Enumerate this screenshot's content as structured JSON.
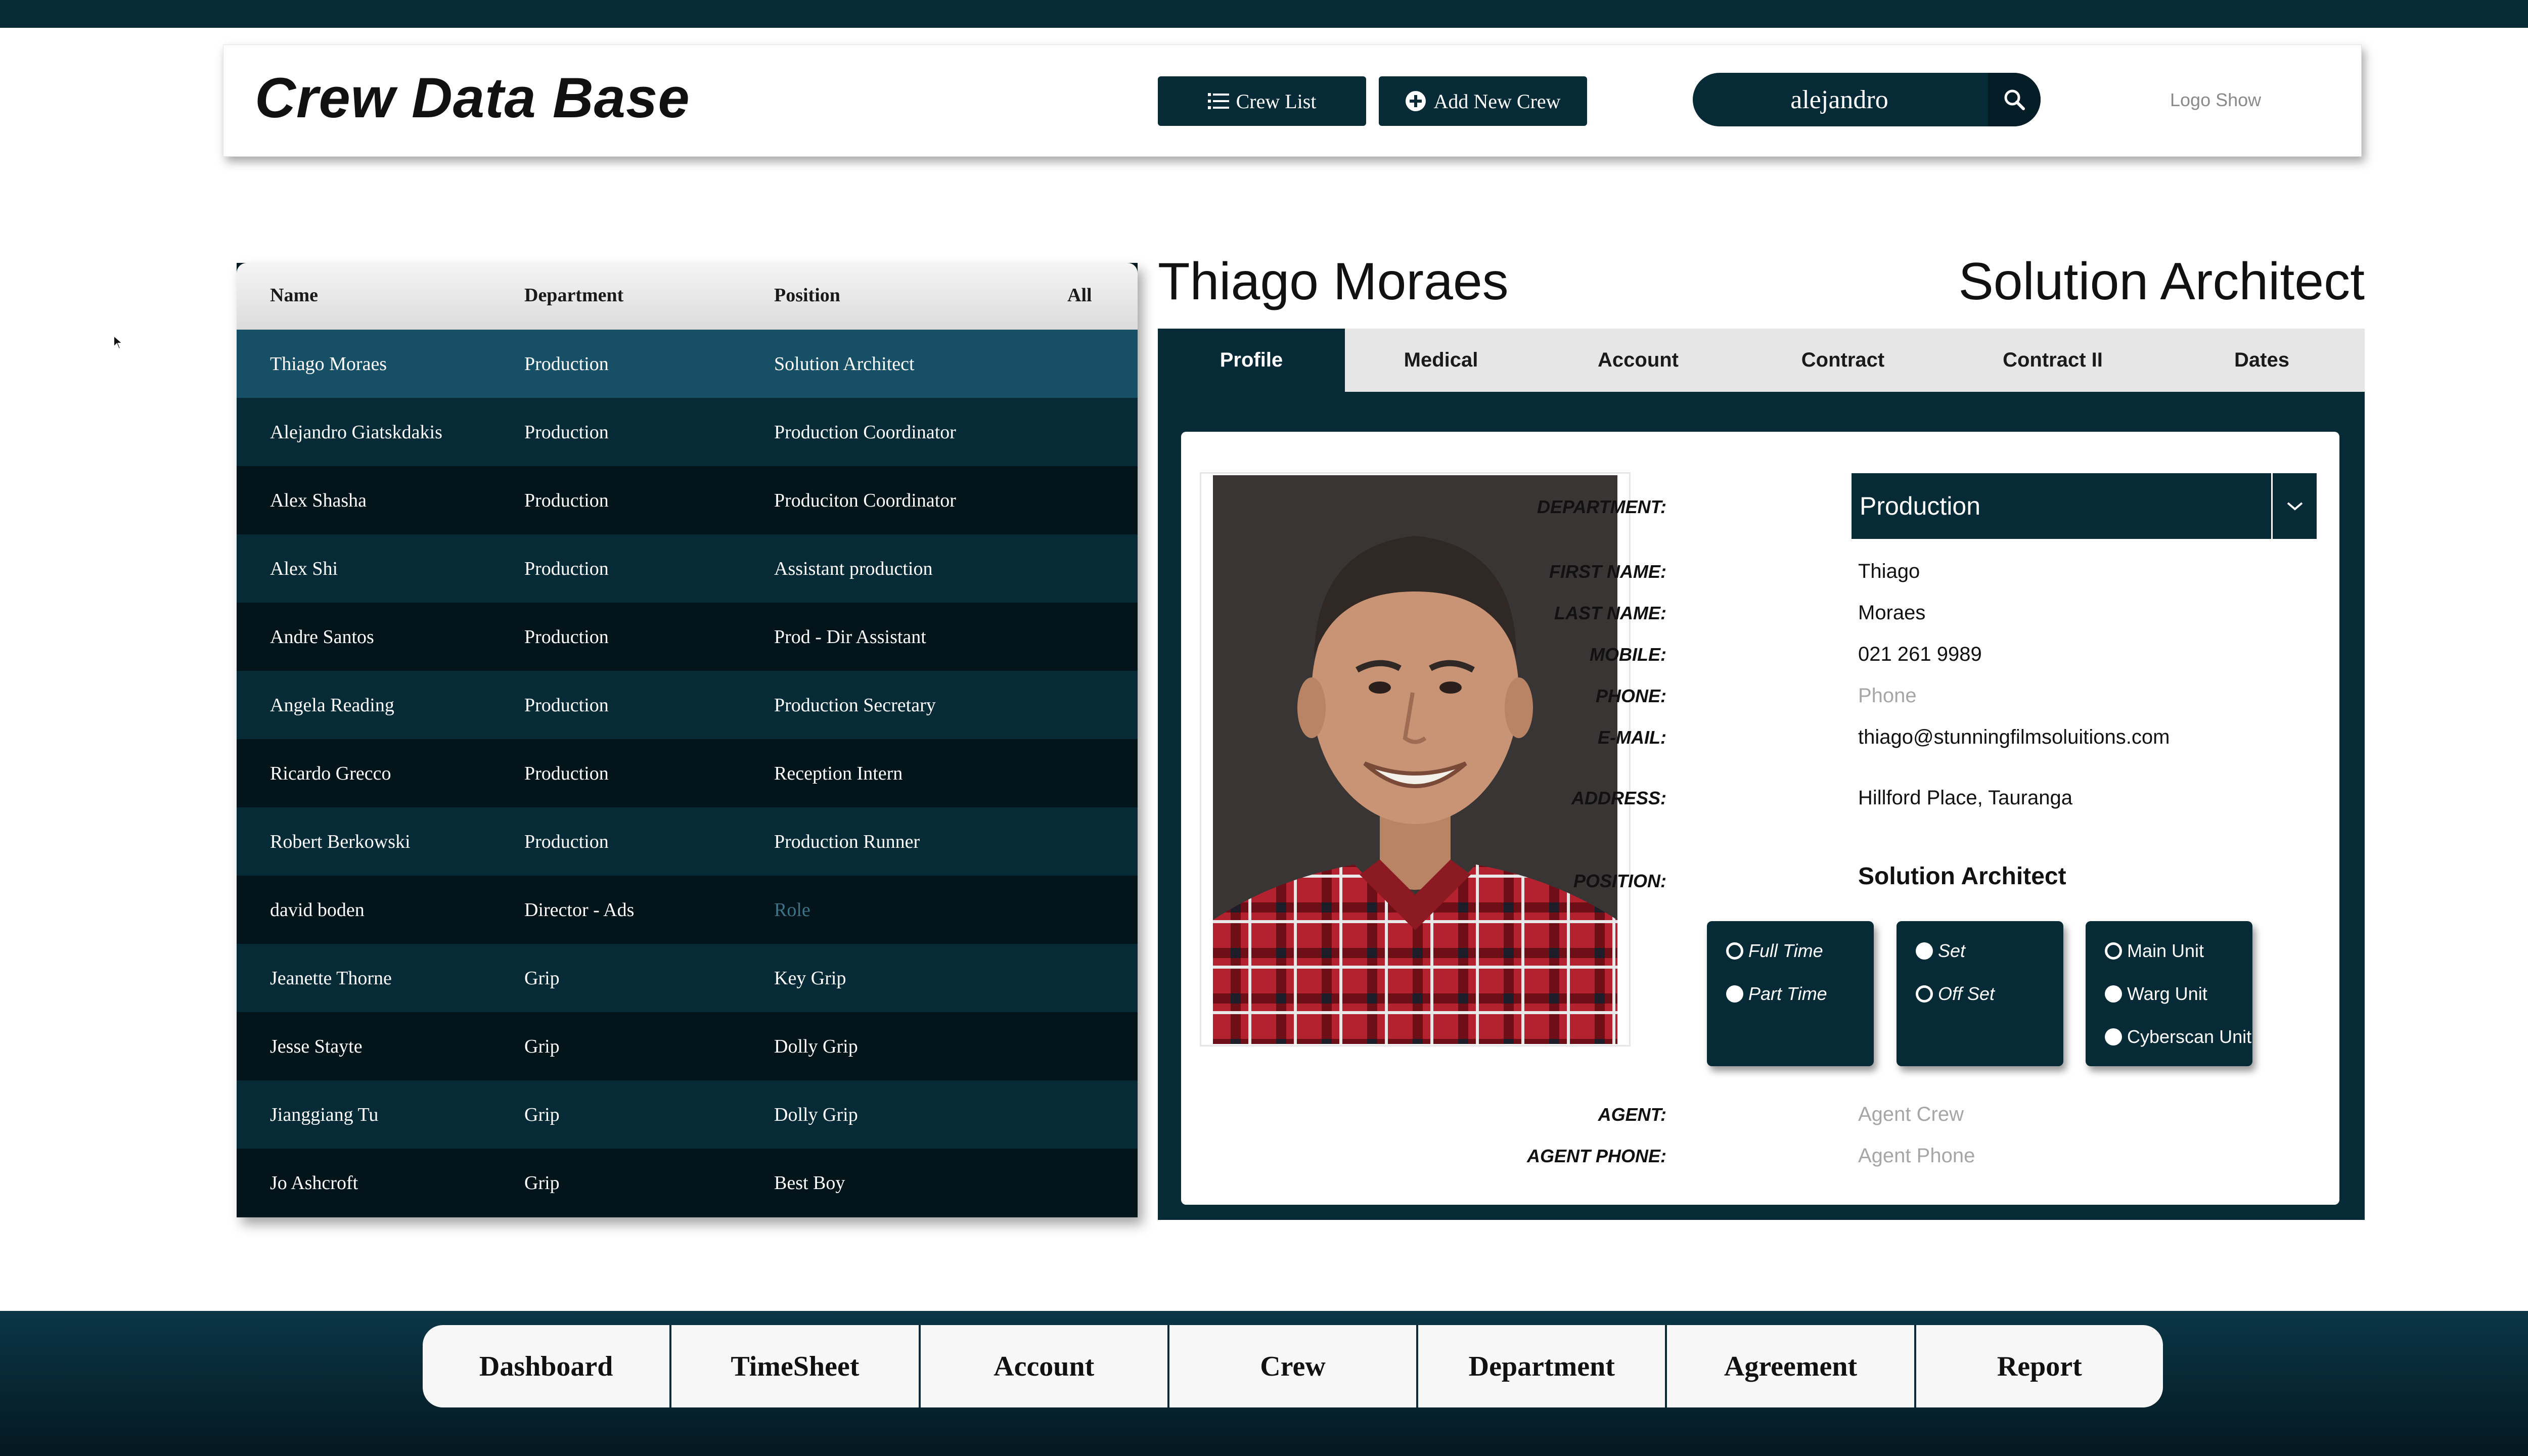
{
  "header": {
    "title": "Crew Data Base",
    "crew_list_label": "Crew List",
    "add_crew_label": "Add New Crew",
    "search_value": "alejandro",
    "logo_text": "Logo Show"
  },
  "table": {
    "columns": [
      "Name",
      "Department",
      "Position",
      "All"
    ],
    "rows": [
      {
        "name": "Thiago Moraes",
        "department": "Production",
        "position": "Solution Architect"
      },
      {
        "name": "Alejandro Giatskdakis",
        "department": "Production",
        "position": "Production Coordinator"
      },
      {
        "name": "Alex Shasha",
        "department": "Production",
        "position": "Produciton Coordinator"
      },
      {
        "name": "Alex Shi",
        "department": "Production",
        "position": "Assistant production"
      },
      {
        "name": "Andre Santos",
        "department": "Production",
        "position": "Prod - Dir Assistant"
      },
      {
        "name": "Angela Reading",
        "department": "Production",
        "position": "Production Secretary"
      },
      {
        "name": "Ricardo Grecco",
        "department": "Production",
        "position": "Reception Intern"
      },
      {
        "name": "Robert Berkowski",
        "department": "Production",
        "position": "Production Runner"
      },
      {
        "name": "david boden",
        "department": "Director - Ads",
        "position": "Role"
      },
      {
        "name": "Jeanette Thorne",
        "department": "Grip",
        "position": "Key Grip"
      },
      {
        "name": "Jesse Stayte",
        "department": "Grip",
        "position": "Dolly Grip"
      },
      {
        "name": "Jianggiang Tu",
        "department": "Grip",
        "position": "Dolly Grip"
      },
      {
        "name": "Jo Ashcroft",
        "department": "Grip",
        "position": "Best Boy"
      }
    ]
  },
  "detail": {
    "name": "Thiago Moraes",
    "role": "Solution Architect",
    "tabs": [
      "Profile",
      "Medical",
      "Account",
      "Contract",
      "Contract II",
      "Dates"
    ],
    "active_tab": "Profile",
    "labels": {
      "department": "DEPARTMENT:",
      "first_name": "FIRST NAME:",
      "last_name": "LAST NAME:",
      "mobile": "MOBILE:",
      "phone": "PHONE:",
      "email": "E-MAIL:",
      "address": "ADDRESS:",
      "position": "POSITION:",
      "agent": "AGENT:",
      "agent_phone": "AGENT PHONE:"
    },
    "values": {
      "department": "Production",
      "first_name": "Thiago",
      "last_name": "Moraes",
      "mobile": "021 261 9989",
      "phone_placeholder": "Phone",
      "email": "thiago@stunningfilmsoluitions.com",
      "address": "Hillford Place, Tauranga",
      "position": "Solution Architect",
      "agent_placeholder": "Agent Crew",
      "agent_phone_placeholder": "Agent Phone"
    },
    "options": {
      "employment": [
        {
          "label": "Full Time",
          "selected": false
        },
        {
          "label": "Part Time",
          "selected": true
        }
      ],
      "location": [
        {
          "label": "Set",
          "selected": true
        },
        {
          "label": "Off Set",
          "selected": false
        }
      ],
      "unit": [
        {
          "label": "Main Unit",
          "selected": false
        },
        {
          "label": "Warg Unit",
          "selected": true
        },
        {
          "label": "Cyberscan Unit",
          "selected": true
        }
      ]
    }
  },
  "nav": [
    "Dashboard",
    "TimeSheet",
    "Account",
    "Crew",
    "Department",
    "Agreement",
    "Report"
  ],
  "colors": {
    "primary": "#062a36",
    "selected_row": "#174f66"
  }
}
